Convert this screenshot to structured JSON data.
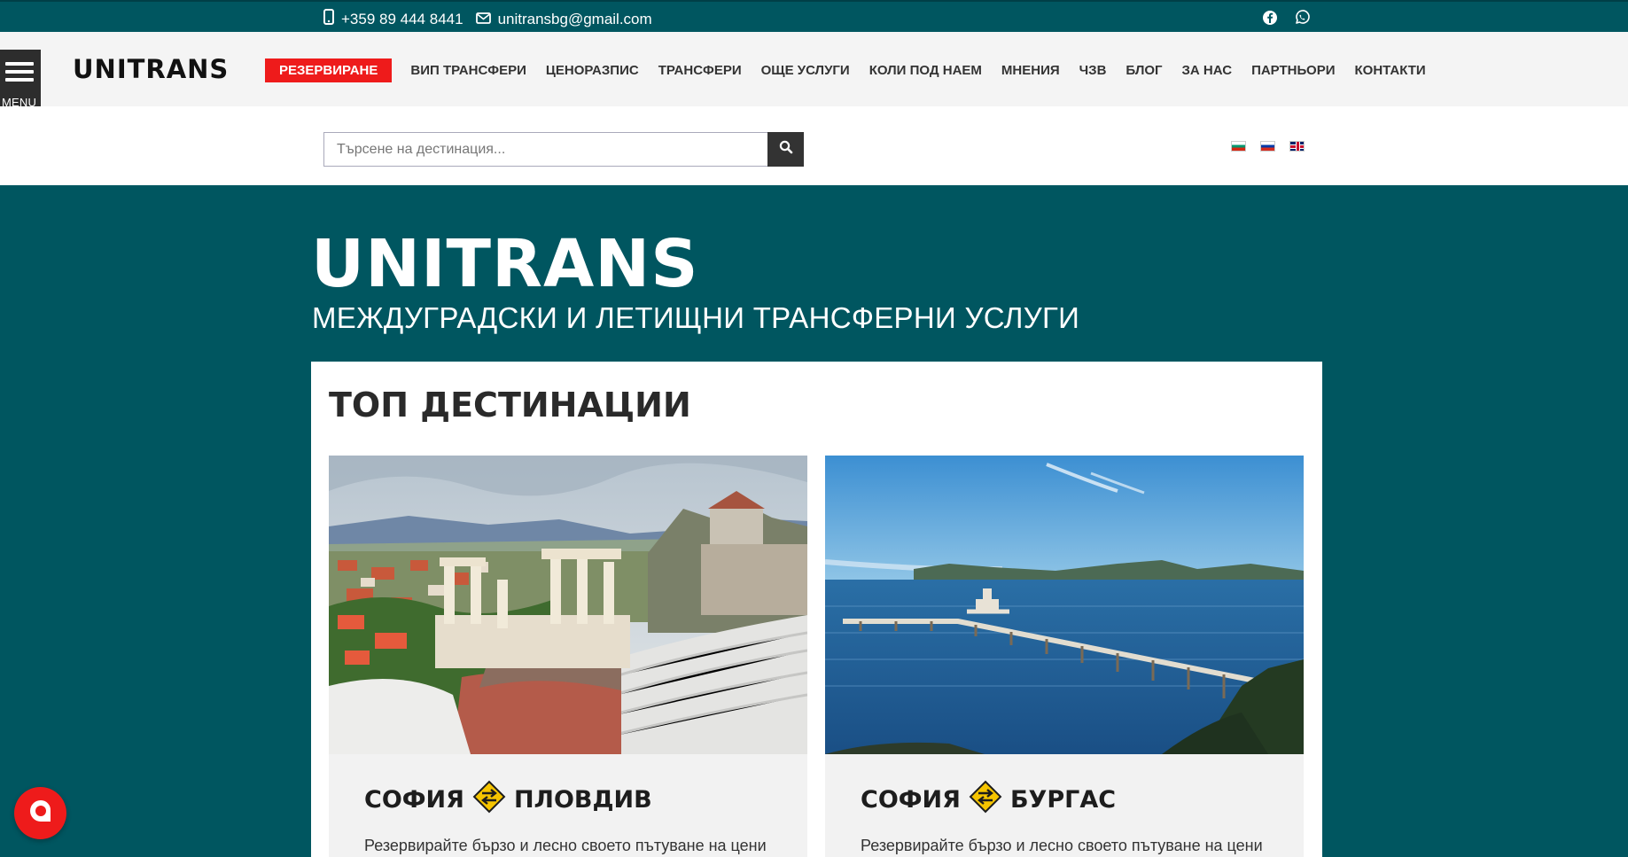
{
  "topbar": {
    "phone": "+359 89 444 8441",
    "email": "unitransbg@gmail.com",
    "social": [
      "facebook-icon",
      "whatsapp-icon"
    ]
  },
  "navbar": {
    "menu_label": "MENU",
    "logo": "UNITRANS",
    "book_label": "РЕЗЕРВИРАНЕ",
    "links": [
      "ВИП ТРАНСФЕРИ",
      "ЦЕНОРАЗПИС",
      "ТРАНСФЕРИ",
      "ОЩЕ УСЛУГИ",
      "КОЛИ ПОД НАЕМ",
      "МНЕНИЯ",
      "ЧЗВ",
      "БЛОГ",
      "ЗА НАС",
      "ПАРТНЬОРИ",
      "КОНТАКТИ"
    ]
  },
  "search": {
    "placeholder": "Търсене на дестинация...",
    "value": ""
  },
  "languages": [
    "bg",
    "ru",
    "en"
  ],
  "hero": {
    "title": "UNITRANS",
    "subtitle": "МЕЖДУГРАДСКИ И ЛЕТИЩНИ ТРАНСФЕРНИ УСЛУГИ"
  },
  "destinations": {
    "heading": "ТОП ДЕСТИНАЦИИ",
    "cards": [
      {
        "from": "СОФИЯ",
        "to": "ПЛОВДИВ",
        "description": "Резервирайте бързо и лесно своето пътуване на цени"
      },
      {
        "from": "СОФИЯ",
        "to": "БУРГАС",
        "description": "Резервирайте бързо и лесно своето пътуване на цени"
      }
    ]
  },
  "colors": {
    "brand_teal": "#005660",
    "accent_red": "#ee1b1b",
    "sign_yellow": "#f5c400"
  }
}
